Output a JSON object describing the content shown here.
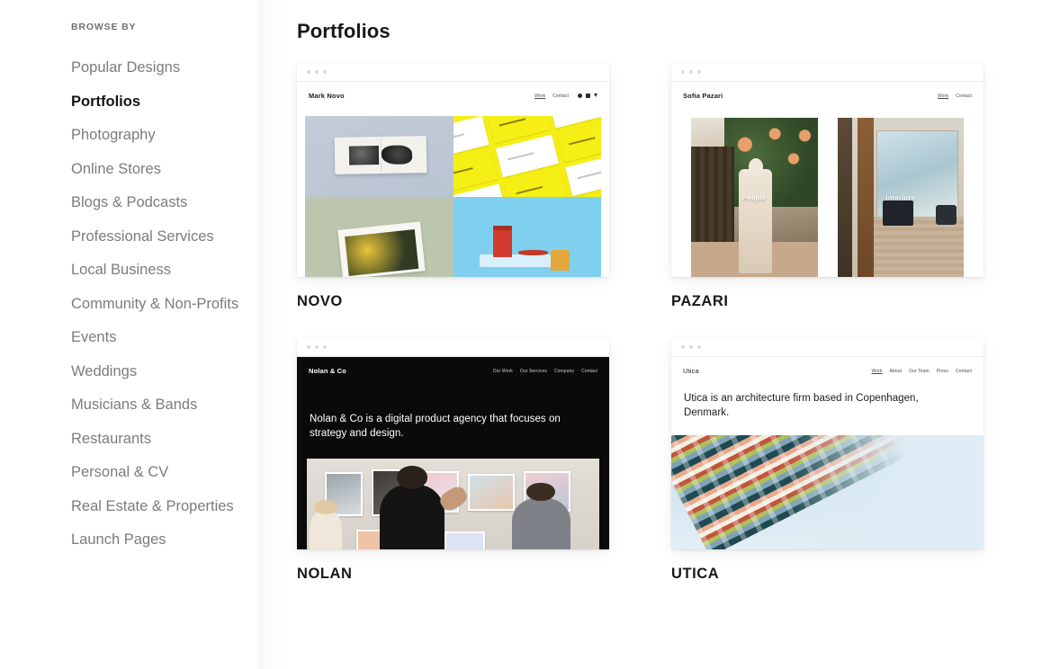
{
  "sidebar": {
    "heading": "BROWSE BY",
    "items": [
      {
        "label": "Popular Designs",
        "active": false
      },
      {
        "label": "Portfolios",
        "active": true
      },
      {
        "label": "Photography",
        "active": false
      },
      {
        "label": "Online Stores",
        "active": false
      },
      {
        "label": "Blogs & Podcasts",
        "active": false
      },
      {
        "label": "Professional Services",
        "active": false
      },
      {
        "label": "Local Business",
        "active": false
      },
      {
        "label": "Community & Non-Profits",
        "active": false
      },
      {
        "label": "Events",
        "active": false
      },
      {
        "label": "Weddings",
        "active": false
      },
      {
        "label": "Musicians & Bands",
        "active": false
      },
      {
        "label": "Restaurants",
        "active": false
      },
      {
        "label": "Personal & CV",
        "active": false
      },
      {
        "label": "Real Estate & Properties",
        "active": false
      },
      {
        "label": "Launch Pages",
        "active": false
      }
    ]
  },
  "main": {
    "title": "Portfolios",
    "templates": [
      {
        "name": "NOVO",
        "site_logo": "Mark Novo",
        "nav": [
          "Work",
          "Contact"
        ],
        "icons": [
          "circle-icon",
          "square-icon",
          "triangle-icon"
        ],
        "theme": "light",
        "image_labels": []
      },
      {
        "name": "PAZARI",
        "site_logo": "Sofia Pazari",
        "nav": [
          "Work",
          "Contact"
        ],
        "icons": [],
        "theme": "light",
        "image_labels": [
          "People",
          "Interiors"
        ]
      },
      {
        "name": "NOLAN",
        "site_logo": "Nolan & Co",
        "nav": [
          "Our Work",
          "Our Services",
          "Company",
          "Contact"
        ],
        "icons": [],
        "theme": "dark",
        "headline": "Nolan & Co is a digital product agency that focuses on strategy and design.",
        "image_labels": []
      },
      {
        "name": "UTICA",
        "site_logo": "Utica",
        "nav": [
          "Work",
          "About",
          "Our Team",
          "Press",
          "Contact"
        ],
        "icons": [],
        "theme": "light",
        "headline": "Utica is an architecture firm based in Copenhagen, Denmark.",
        "image_labels": []
      }
    ]
  },
  "colors": {
    "text_primary": "#17181a",
    "text_muted": "#7b7c7e",
    "page_bg": "#ffffff",
    "accent_yellow": "#f6ef16",
    "dark_card": "#0a0a0a"
  }
}
